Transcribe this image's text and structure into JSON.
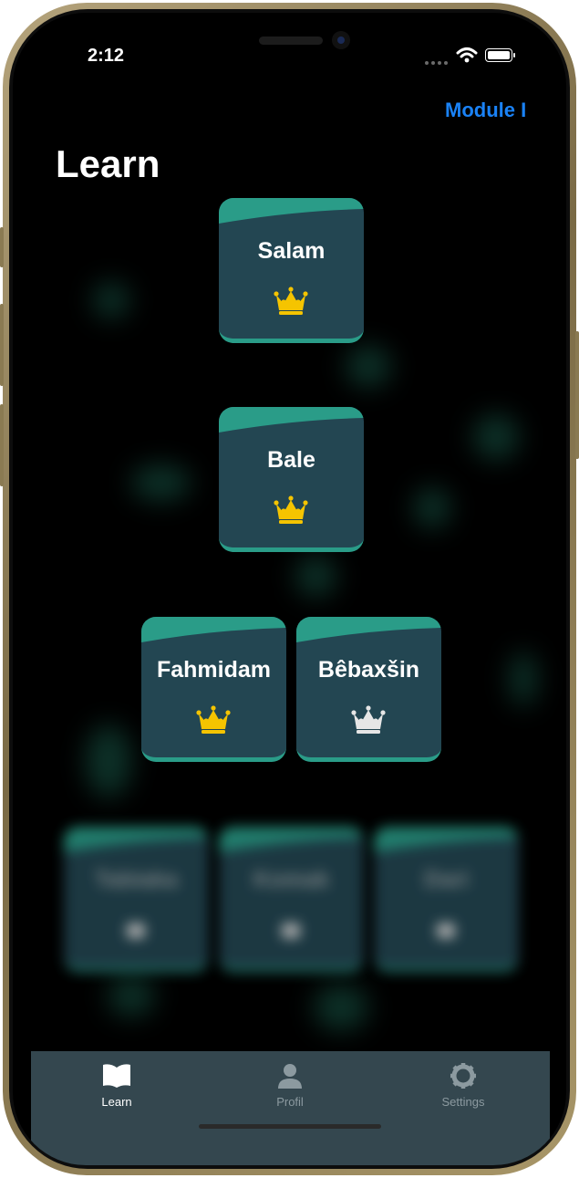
{
  "status_bar": {
    "time": "2:12"
  },
  "header": {
    "module_link": "Module I",
    "title": "Learn"
  },
  "lessons": [
    {
      "label": "Salam",
      "crown": "gold",
      "locked": false
    },
    {
      "label": "Bale",
      "crown": "gold",
      "locked": false
    },
    {
      "label": "Fahmidam",
      "crown": "gold",
      "locked": false
    },
    {
      "label": "Bêbaxšin",
      "crown": "silver",
      "locked": false
    },
    {
      "label": "Tabiaka",
      "crown": "hidden",
      "locked": true
    },
    {
      "label": "Komak",
      "crown": "hidden",
      "locked": true
    },
    {
      "label": "Dari",
      "crown": "hidden",
      "locked": true
    }
  ],
  "tabbar": {
    "tabs": [
      {
        "label": "Learn",
        "icon": "book-icon",
        "active": true
      },
      {
        "label": "Profil",
        "icon": "person-icon",
        "active": false
      },
      {
        "label": "Settings",
        "icon": "gear-icon",
        "active": false
      }
    ]
  },
  "colors": {
    "accent": "#1a82f6",
    "card_fill": "#234652",
    "card_cap": "#2a9c88",
    "crown_gold": "#f5c400",
    "crown_silver": "#e6e6e6",
    "tabbar_bg": "#34474f",
    "tab_active": "#ffffff",
    "tab_inactive": "#8c9aa0"
  }
}
